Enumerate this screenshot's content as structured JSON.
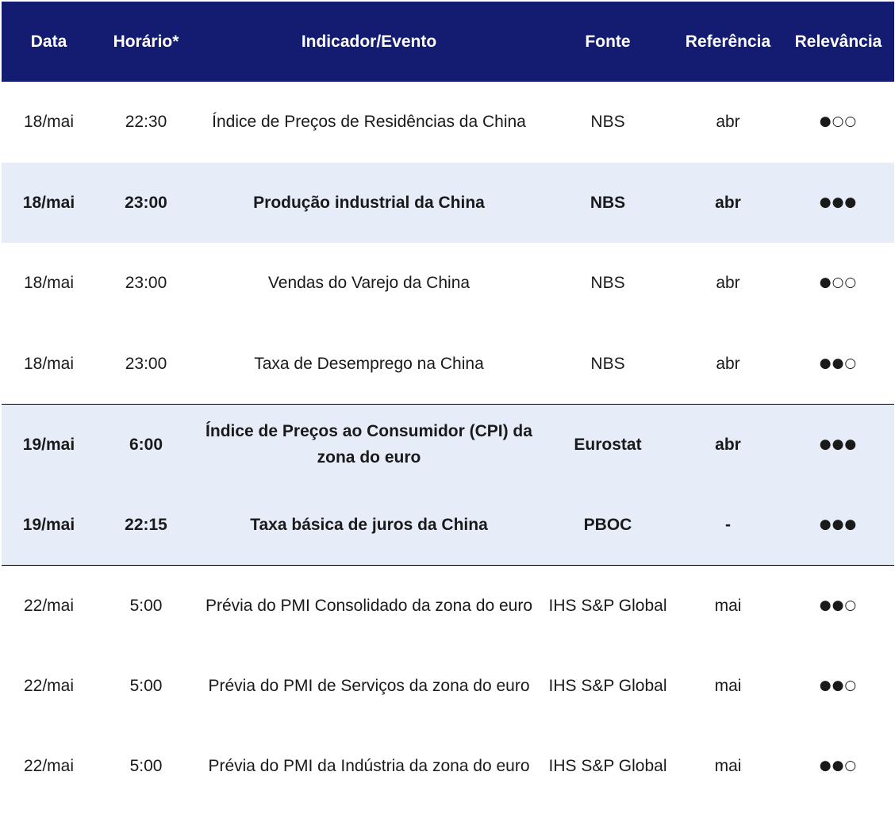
{
  "header": {
    "date": "Data",
    "time": "Horário*",
    "event": "Indicador/Evento",
    "source": "Fonte",
    "reference": "Referência",
    "relevance": "Relevância"
  },
  "rows": [
    {
      "date": "18/mai",
      "time": "22:30",
      "event": "Índice de Preços de Residências da China",
      "source": "NBS",
      "reference": "abr",
      "relevance": "●○○"
    },
    {
      "date": "18/mai",
      "time": "23:00",
      "event": "Produção industrial da China",
      "source": "NBS",
      "reference": "abr",
      "relevance": "●●●"
    },
    {
      "date": "18/mai",
      "time": "23:00",
      "event": "Vendas do Varejo da China",
      "source": "NBS",
      "reference": "abr",
      "relevance": "●○○"
    },
    {
      "date": "18/mai",
      "time": "23:00",
      "event": "Taxa de Desemprego na China",
      "source": "NBS",
      "reference": "abr",
      "relevance": "●●○"
    },
    {
      "date": "19/mai",
      "time": "6:00",
      "event": "Índice de Preços ao Consumidor (CPI) da zona do euro",
      "source": "Eurostat",
      "reference": "abr",
      "relevance": "●●●"
    },
    {
      "date": "19/mai",
      "time": "22:15",
      "event": "Taxa básica de juros da China",
      "source": "PBOC",
      "reference": "-",
      "relevance": "●●●"
    },
    {
      "date": "22/mai",
      "time": "5:00",
      "event": "Prévia do PMI Consolidado da zona do euro",
      "source": "IHS S&P Global",
      "reference": "mai",
      "relevance": "●●○"
    },
    {
      "date": "22/mai",
      "time": "5:00",
      "event": "Prévia do PMI de Serviços da zona do euro",
      "source": "IHS S&P Global",
      "reference": "mai",
      "relevance": "●●○"
    },
    {
      "date": "22/mai",
      "time": "5:00",
      "event": "Prévia do PMI da Indústria da zona do euro",
      "source": "IHS S&P Global",
      "reference": "mai",
      "relevance": "●●○"
    }
  ],
  "colors": {
    "header_bg": "#141c72",
    "highlight_bg": "#e6ecf8"
  }
}
